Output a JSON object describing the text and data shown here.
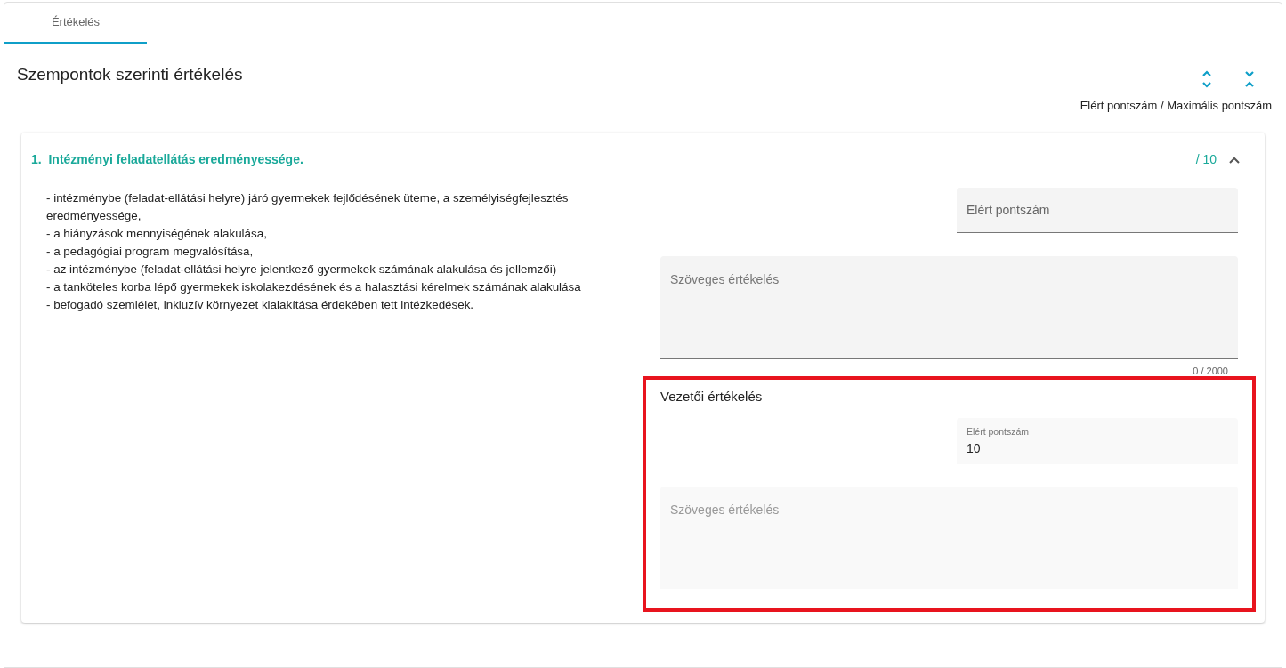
{
  "tabs": [
    {
      "label": "Értékelés",
      "selected": true
    }
  ],
  "page_title": "Szempontok szerinti értékelés",
  "score_legend": "Elért pontszám / Maximális pontszám",
  "criteria": [
    {
      "number": "1.",
      "title": "Intézményi feladatellátás eredményessége.",
      "max_score": "/ 10",
      "expanded": true,
      "description": [
        "- intézménybe (feladat-ellátási helyre) járó gyermekek fejlődésének üteme, a személyiségfejlesztés eredményessége,",
        "- a hiányzások mennyiségének alakulása,",
        "- a pedagógiai program megvalósítása,",
        "- az intézménybe (feladat-ellátási helyre jelentkező gyermekek számának alakulása és jellemzői)",
        "- a tanköteles korba lépő gyermekek iskolakezdésének és a halasztási kérelmek számának alakulása",
        "- befogadó szemlélet, inkluzív környezet kialakítása érdekében tett intézkedések."
      ],
      "score_field": {
        "placeholder": "Elért pontszám"
      },
      "text_field": {
        "placeholder": "Szöveges értékelés",
        "counter": "0 / 2000"
      },
      "manager_review": {
        "title": "Vezetői értékelés",
        "highlighted": true,
        "score_field": {
          "label": "Elért pontszám",
          "value": "10"
        },
        "text_field": {
          "placeholder": "Szöveges értékelés"
        }
      }
    }
  ]
}
